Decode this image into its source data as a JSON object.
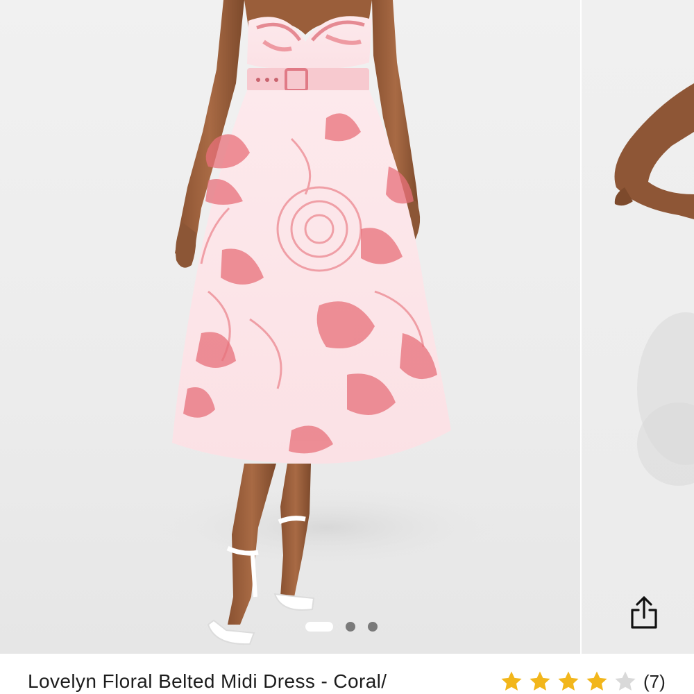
{
  "product": {
    "title": "Lovelyn Floral Belted Midi Dress - Coral/",
    "rating_value": 4,
    "rating_max": 5,
    "review_count": "(7)"
  },
  "gallery": {
    "current_slide": 1,
    "total_slides": 3
  },
  "colors": {
    "star_filled": "#F2B61B",
    "star_empty": "#D9D9D9",
    "dot_active": "#FFFFFF",
    "dot_inactive": "#7A7A7A",
    "dress_print": "#E8707A",
    "dress_base": "#FBE3E6"
  },
  "icons": {
    "share": "share-icon",
    "star": "star-icon"
  }
}
